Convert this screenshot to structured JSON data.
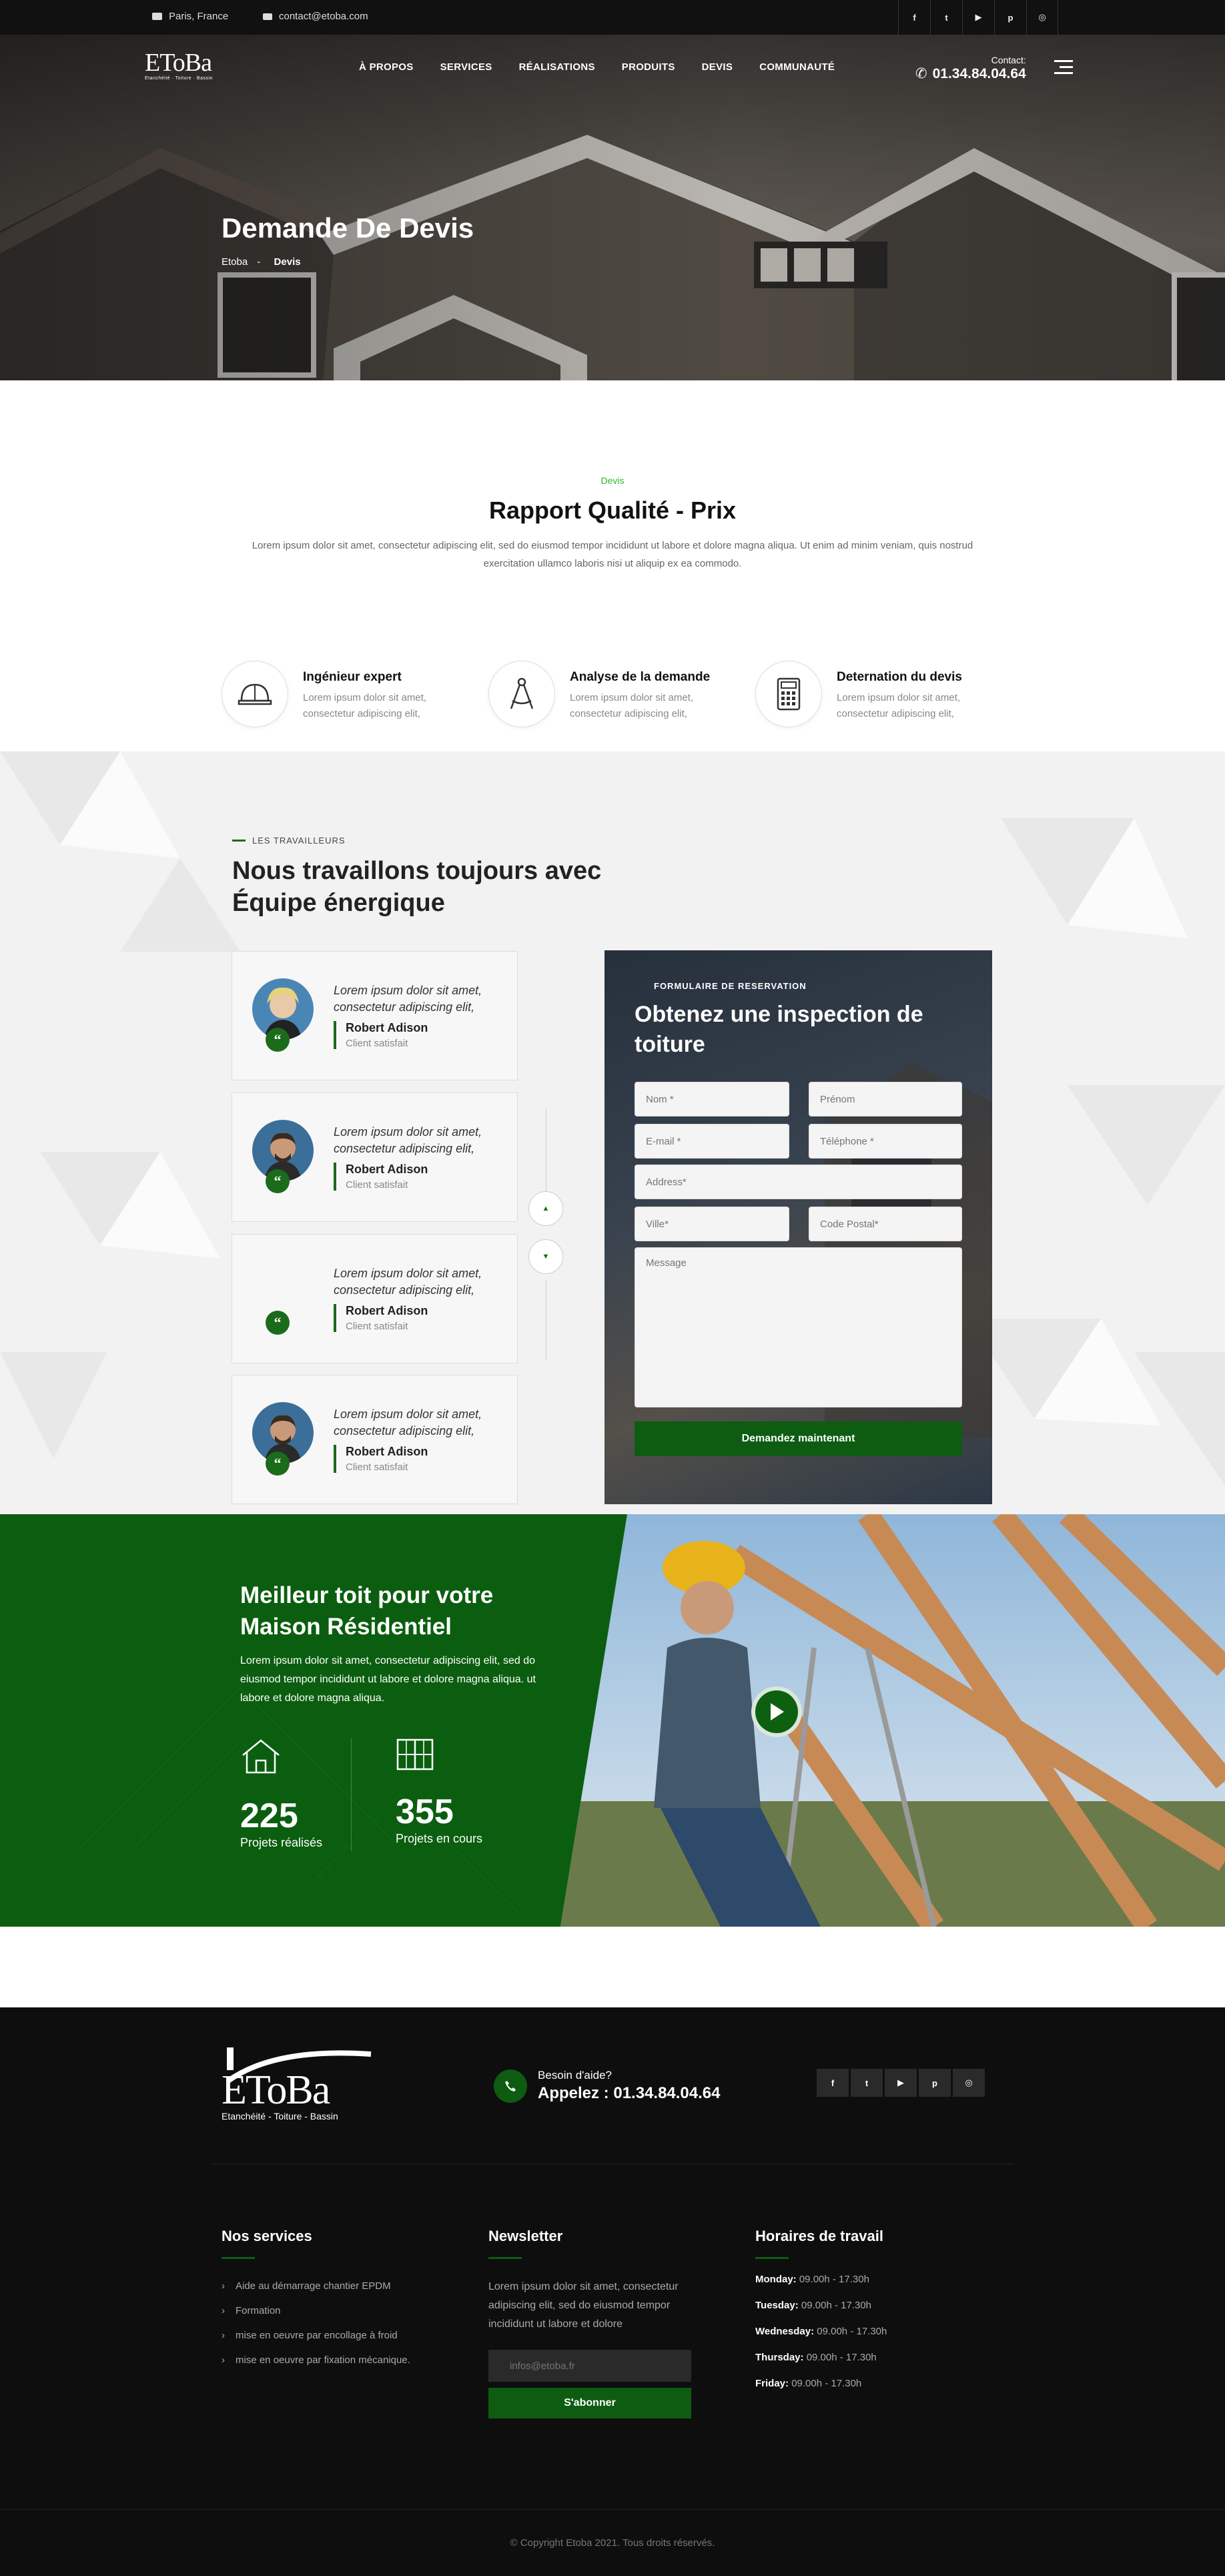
{
  "topbar": {
    "location": "Paris, France",
    "email": "contact@etoba.com",
    "socials": [
      "f",
      "t",
      "▶",
      "p",
      "◎"
    ]
  },
  "header": {
    "logo": "EToBa",
    "logo_sub": "Etanchéité · Toiture · Bassin",
    "nav": [
      "À PROPOS",
      "SERVICES",
      "RÉALISATIONS",
      "PRODUITS",
      "DEVIS",
      "COMMUNAUTÉ"
    ],
    "contact_label": "Contact:",
    "phone": "01.34.84.04.64"
  },
  "hero": {
    "title": "Demande De Devis",
    "crumb_home": "Etoba",
    "crumb_sep": "-",
    "crumb_current": "Devis"
  },
  "intro": {
    "tag": "Devis",
    "title": "Rapport Qualité - Prix",
    "text": "Lorem ipsum dolor sit amet, consectetur adipiscing elit, sed do eiusmod tempor incididunt ut labore et dolore magna aliqua. Ut enim ad minim veniam, quis nostrud exercitation ullamco laboris nisi ut aliquip ex ea commodo."
  },
  "features": [
    {
      "title": "Ingénieur expert",
      "text": "Lorem ipsum dolor sit amet, consectetur adipiscing elit,",
      "icon": "helmet-icon"
    },
    {
      "title": "Analyse de la demande",
      "text": "Lorem ipsum dolor sit amet, consectetur adipiscing elit,",
      "icon": "compass-icon"
    },
    {
      "title": "Deternation du devis",
      "text": "Lorem ipsum dolor sit amet, consectetur adipiscing elit,",
      "icon": "calculator-icon"
    }
  ],
  "team": {
    "tag": "LES TRAVAILLEURS",
    "title_line1": "Nous travaillons toujours avec",
    "title_line2": "Équipe énergique",
    "testimonials": [
      {
        "text": "Lorem ipsum dolor sit amet, consectetur adipiscing elit,",
        "name": "Robert Adison",
        "role": "Client satisfait"
      },
      {
        "text": "Lorem ipsum dolor sit amet, consectetur adipiscing elit,",
        "name": "Robert Adison",
        "role": "Client satisfait"
      },
      {
        "text": "Lorem ipsum dolor sit amet, consectetur adipiscing elit,",
        "name": "Robert Adison",
        "role": "Client satisfait"
      },
      {
        "text": "Lorem ipsum dolor sit amet, consectetur adipiscing elit,",
        "name": "Robert Adison",
        "role": "Client satisfait"
      }
    ],
    "quote_glyph": "“"
  },
  "form": {
    "tag": "FORMULAIRE DE RESERVATION",
    "title": "Obtenez une inspection de toiture",
    "nom": "Nom *",
    "prenom": "Prénom",
    "email": "E-mail *",
    "telephone": "Téléphone *",
    "address": "Address*",
    "ville": "Ville*",
    "code_postal": "Code Postal*",
    "message": "Message",
    "submit": "Demandez maintenant"
  },
  "best": {
    "title_line1": "Meilleur toit pour votre",
    "title_line2": "Maison Résidentiel",
    "text": "Lorem ipsum dolor sit amet, consectetur adipiscing elit, sed do eiusmod tempor incididunt ut labore et dolore magna aliqua. ut labore et dolore magna aliqua.",
    "stats": [
      {
        "value": "225",
        "label": "Projets réalisés"
      },
      {
        "value": "355",
        "label": "Projets en cours"
      }
    ]
  },
  "footer": {
    "logo": "EToBa",
    "logo_sub": "Etanchéité - Toiture - Bassin",
    "help_label": "Besoin d'aide?",
    "help_phone": "Appelez : 01.34.84.04.64",
    "services_title": "Nos services",
    "services": [
      "Aide au démarrage chantier EPDM",
      "Formation",
      "mise en oeuvre par encollage à froid",
      "mise en oeuvre par fixation mécanique."
    ],
    "newsletter_title": "Newsletter",
    "newsletter_text": "Lorem ipsum dolor sit amet, consectetur adipiscing elit, sed do eiusmod tempor incididunt ut labore et dolore",
    "newsletter_placeholder": "infos@etoba.fr",
    "subscribe": "S'abonner",
    "hours_title": "Horaires de travail",
    "hours": [
      {
        "day": "Monday:",
        "time": "09.00h - 17.30h"
      },
      {
        "day": "Tuesday:",
        "time": "09.00h - 17.30h"
      },
      {
        "day": "Wednesday:",
        "time": "09.00h - 17.30h"
      },
      {
        "day": "Thursday:",
        "time": "09.00h - 17.30h"
      },
      {
        "day": "Friday:",
        "time": "09.00h - 17.30h"
      }
    ],
    "copyright": "© Copyright Etoba 2021. Tous droits réservés."
  },
  "colors": {
    "accent": "#0d5c12",
    "accent_light": "#2eb82e",
    "dark": "#0e0e0e"
  }
}
